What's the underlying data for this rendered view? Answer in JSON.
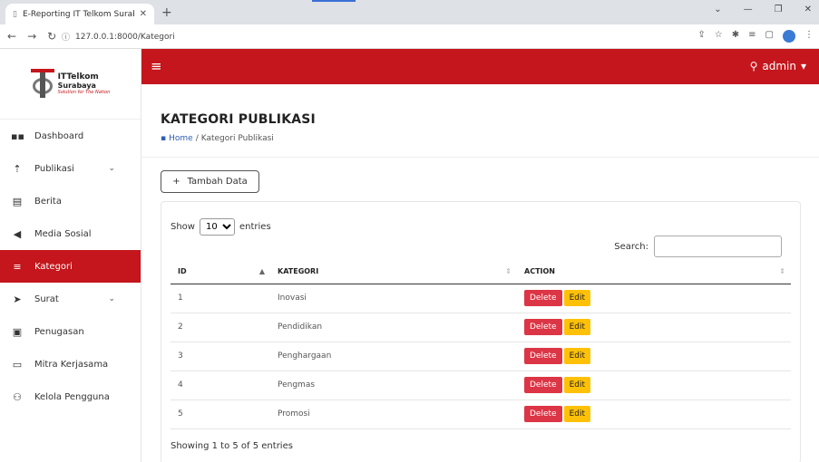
{
  "browser": {
    "tab_title": "E-Reporting IT Telkom Surabaya",
    "tab_close": "✕",
    "new_tab": "+",
    "url": "127.0.0.1:8000/Kategori",
    "win_min": "—",
    "win_restore": "❐",
    "win_close": "✕",
    "win_dropdown": "⌄"
  },
  "logo": {
    "line1": "ITTelkom",
    "line2": "Surabaya",
    "tagline": "Solution for The Nation"
  },
  "sidebar": {
    "items": [
      {
        "label": "Dashboard",
        "icon": "dashboard-icon"
      },
      {
        "label": "Publikasi",
        "icon": "upload-icon"
      },
      {
        "label": "Berita",
        "icon": "news-icon"
      },
      {
        "label": "Media Sosial",
        "icon": "megaphone-icon"
      },
      {
        "label": "Kategori",
        "icon": "list-icon"
      },
      {
        "label": "Surat",
        "icon": "send-icon"
      },
      {
        "label": "Penugasan",
        "icon": "clipboard-icon"
      },
      {
        "label": "Mitra Kerjasama",
        "icon": "id-card-icon"
      },
      {
        "label": "Kelola Pengguna",
        "icon": "users-icon"
      }
    ]
  },
  "header": {
    "user": "admin"
  },
  "page": {
    "title": "KATEGORI PUBLIKASI",
    "breadcrumb_home": "Home",
    "breadcrumb_sep": "/",
    "breadcrumb_current": "Kategori Publikasi",
    "add_button": "Tambah Data"
  },
  "table": {
    "show_label": "Show",
    "show_value": "10",
    "entries_label": "entries",
    "search_label": "Search:",
    "columns": [
      "ID",
      "KATEGORI",
      "ACTION"
    ],
    "rows": [
      {
        "id": "1",
        "kategori": "Inovasi"
      },
      {
        "id": "2",
        "kategori": "Pendidikan"
      },
      {
        "id": "3",
        "kategori": "Penghargaan"
      },
      {
        "id": "4",
        "kategori": "Pengmas"
      },
      {
        "id": "5",
        "kategori": "Promosi"
      }
    ],
    "delete_label": "Delete",
    "edit_label": "Edit",
    "info": "Showing 1 to 5 of 5 entries"
  },
  "colors": {
    "brand_red": "#c4161c",
    "delete": "#dc3545",
    "edit": "#ffc107"
  }
}
